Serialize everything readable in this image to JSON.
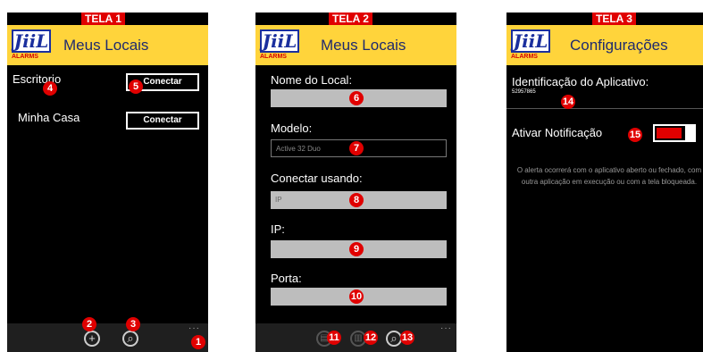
{
  "logo": {
    "letters": "JiiL",
    "brand": "ALARMS"
  },
  "screen1": {
    "tag": "TELA 1",
    "title": "Meus Locais",
    "items": [
      {
        "name": "Escritorio",
        "button": "Conectar"
      },
      {
        "name": "Minha Casa",
        "button": "Conectar"
      }
    ],
    "appbar": {
      "add_glyph": "+",
      "search_glyph": "⌕",
      "more": "···"
    }
  },
  "screen2": {
    "tag": "TELA 2",
    "title": "Meus Locais",
    "fields": [
      {
        "label": "Nome do Local:",
        "value": ""
      },
      {
        "label": "Modelo:",
        "value": "Active 32 Duo"
      },
      {
        "label": "Conectar usando:",
        "value": "IP"
      },
      {
        "label": "IP:",
        "value": ""
      },
      {
        "label": "Porta:",
        "value": ""
      }
    ],
    "appbar": {
      "save_glyph": "▤",
      "delete_glyph": "▥",
      "search_glyph": "⌕",
      "more": "···"
    }
  },
  "screen3": {
    "tag": "TELA 3",
    "title": "Configurações",
    "app_id_label": "Identificação do Aplicativo:",
    "app_id_value": "52957865",
    "notification_label": "Ativar Notificação",
    "notification_on": true,
    "note": "O alerta ocorrerá com o aplicativo aberto ou fechado, com outra aplicação em execução ou com a tela bloqueada."
  },
  "markers": [
    "1",
    "2",
    "3",
    "4",
    "5",
    "6",
    "7",
    "8",
    "9",
    "10",
    "11",
    "12",
    "13",
    "14",
    "15"
  ],
  "colors": {
    "header": "#ffd43b",
    "marker": "#e00000",
    "logo_blue": "#1b2f9e",
    "field": "#bdbdbd"
  }
}
